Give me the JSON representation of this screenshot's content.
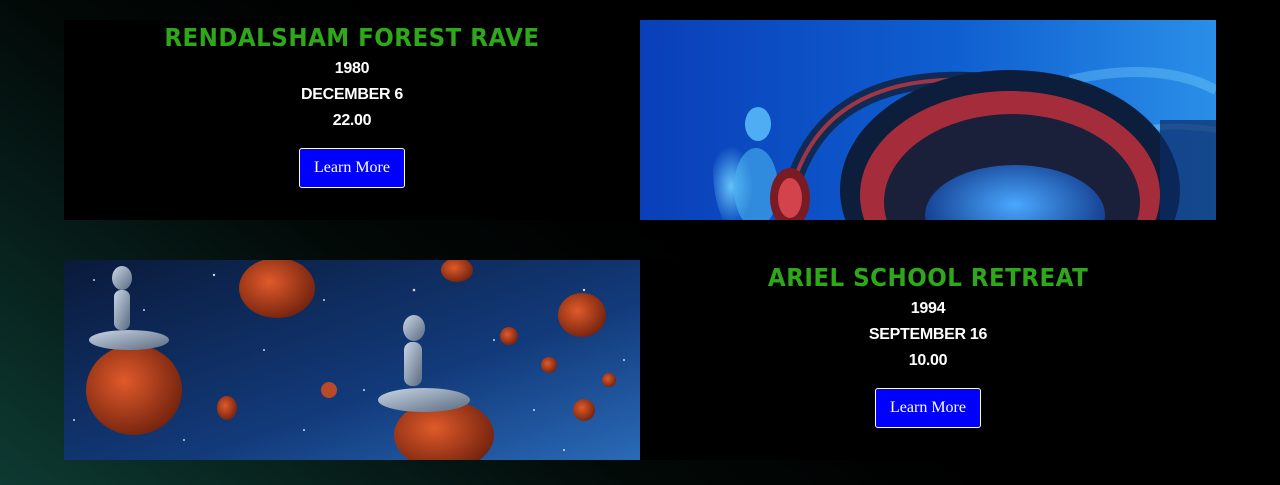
{
  "events": [
    {
      "title": "RENDALSHAM FOREST RAVE",
      "year": "1980",
      "date": "DECEMBER 6",
      "time": "22.00",
      "button_label": "Learn More",
      "image_icon": "headphones-alien-image"
    },
    {
      "title": "ARIEL SCHOOL RETREAT",
      "year": "1994",
      "date": "SEPTEMBER 16",
      "time": "10.00",
      "button_label": "Learn More",
      "image_icon": "meditating-aliens-asteroids-image"
    }
  ],
  "colors": {
    "title_green": "#2ea81a",
    "button_blue": "#0000ff",
    "background": "#000000",
    "gradient_teal": "#0d3a32"
  }
}
